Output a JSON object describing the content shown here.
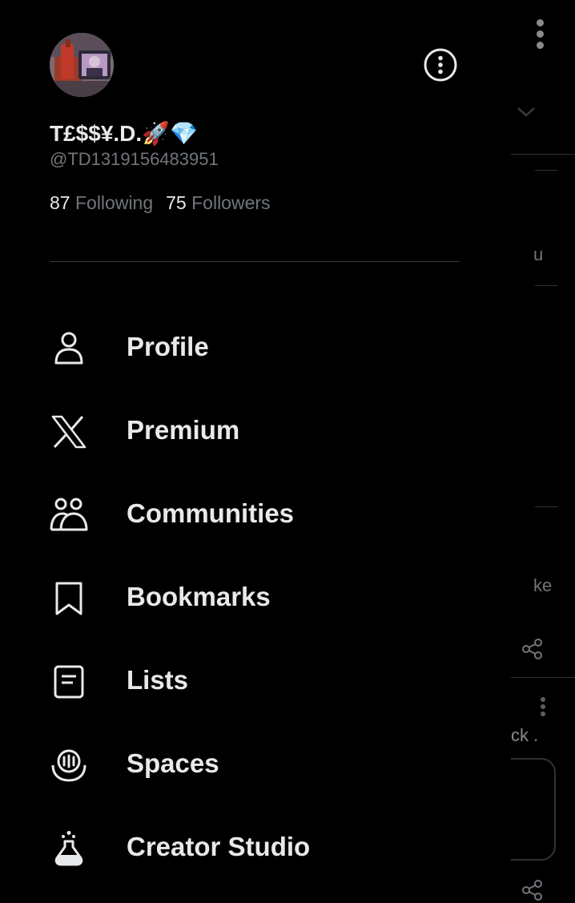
{
  "profile": {
    "display_name": "T£$$¥.D.🚀💎",
    "handle": "@TD1319156483951",
    "following_count": "87",
    "following_label": "Following",
    "followers_count": "75",
    "followers_label": "Followers"
  },
  "menu": {
    "items": [
      {
        "label": "Profile",
        "icon": "person-icon"
      },
      {
        "label": "Premium",
        "icon": "x-logo-icon"
      },
      {
        "label": "Communities",
        "icon": "communities-icon"
      },
      {
        "label": "Bookmarks",
        "icon": "bookmark-icon"
      },
      {
        "label": "Lists",
        "icon": "list-icon"
      },
      {
        "label": "Spaces",
        "icon": "spaces-icon"
      },
      {
        "label": "Creator Studio",
        "icon": "flask-icon"
      }
    ]
  },
  "background": {
    "snippet_1": "u",
    "snippet_2": "ke",
    "snippet_3": "ck ."
  },
  "colors": {
    "background": "#000000",
    "primary_text": "#e7e9ea",
    "secondary_text": "#71767b",
    "divider": "#3a3d41"
  }
}
